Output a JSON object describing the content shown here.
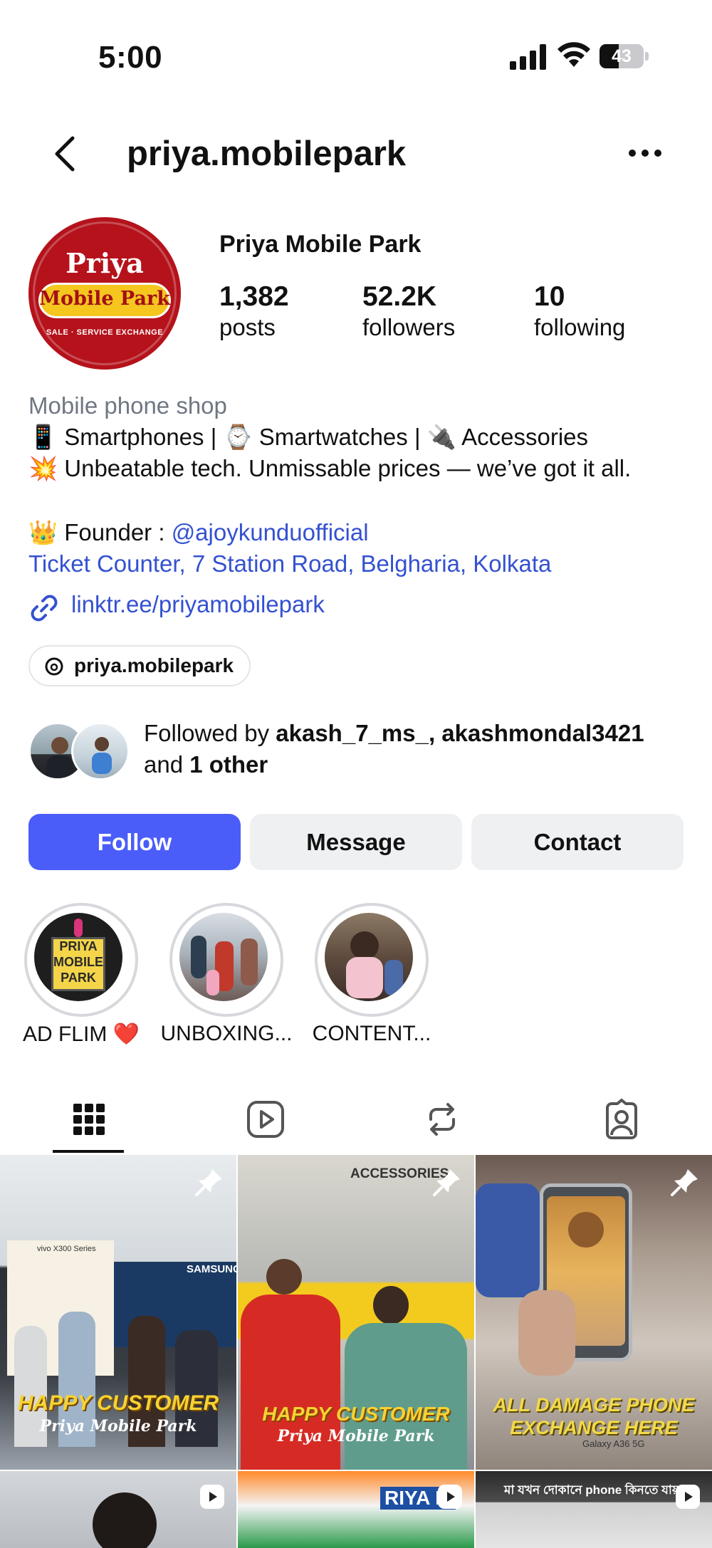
{
  "status_bar": {
    "time": "5:00",
    "battery_percent": "43",
    "battery_level": 0.43
  },
  "nav": {
    "username": "priya.mobilepark"
  },
  "profile": {
    "avatar_text": {
      "line1": "Priya",
      "line2": "Mobile Park",
      "line3": "SALE · SERVICE EXCHANGE"
    },
    "display_name": "Priya Mobile Park",
    "stats": [
      {
        "value": "1,382",
        "label": "posts"
      },
      {
        "value": "52.2K",
        "label": "followers"
      },
      {
        "value": "10",
        "label": "following"
      }
    ],
    "category": "Mobile phone shop",
    "bio_line1": "📱 Smartphones | ⌚ Smartwatches | 🔌 Accessories",
    "bio_line2": "💥 Unbeatable tech. Unmissable prices — we’ve got it all.",
    "founder_prefix": "👑 Founder : ",
    "founder_handle": "@ajoykunduofficial",
    "address": "Ticket Counter, 7 Station Road, Belgharia, Kolkata",
    "link": "linktr.ee/priyamobilepark",
    "threads_handle": "priya.mobilepark"
  },
  "mutuals": {
    "prefix": "Followed by ",
    "names": "akash_7_ms_, akashmondal3421",
    "and": "and ",
    "other": "1 other"
  },
  "actions": {
    "follow": "Follow",
    "message": "Message",
    "contact": "Contact"
  },
  "highlights": [
    {
      "label": "AD FLIM ❤️",
      "cover_text": "PRIYA MOBILE PARK"
    },
    {
      "label": "UNBOXING..."
    },
    {
      "label": "CONTENT..."
    }
  ],
  "tabs": [
    {
      "name": "posts-grid",
      "icon": "grid-icon",
      "active": true
    },
    {
      "name": "reels",
      "icon": "reels-icon",
      "active": false
    },
    {
      "name": "reposts",
      "icon": "repost-icon",
      "active": false
    },
    {
      "name": "tagged",
      "icon": "tagged-icon",
      "active": false
    }
  ],
  "posts": [
    {
      "caption1": "HAPPY CUSTOMER",
      "caption2": "Priya Mobile Park",
      "pinned": true,
      "sign": "SAMSUNG",
      "sign2": "vivo X300 Series"
    },
    {
      "caption1": "HAPPY CUSTOMER",
      "caption2": "Priya Mobile Park",
      "pinned": true,
      "sign": "ACCESSORIES"
    },
    {
      "caption1": "ALL DAMAGE PHONE",
      "caption2": "EXCHANGE HERE",
      "pinned": true,
      "sign": "Galaxy A36 5G"
    },
    {
      "reel": true
    },
    {
      "reel": true,
      "sign": "RIYA M"
    },
    {
      "reel": true,
      "top_caption": "মা যখন দোকানে phone কিনতে যায়"
    }
  ],
  "colors": {
    "follow_blue": "#4a5df9",
    "link_blue": "#3451d1",
    "brand_red": "#b5121b",
    "brand_yellow": "#f4c61e"
  }
}
